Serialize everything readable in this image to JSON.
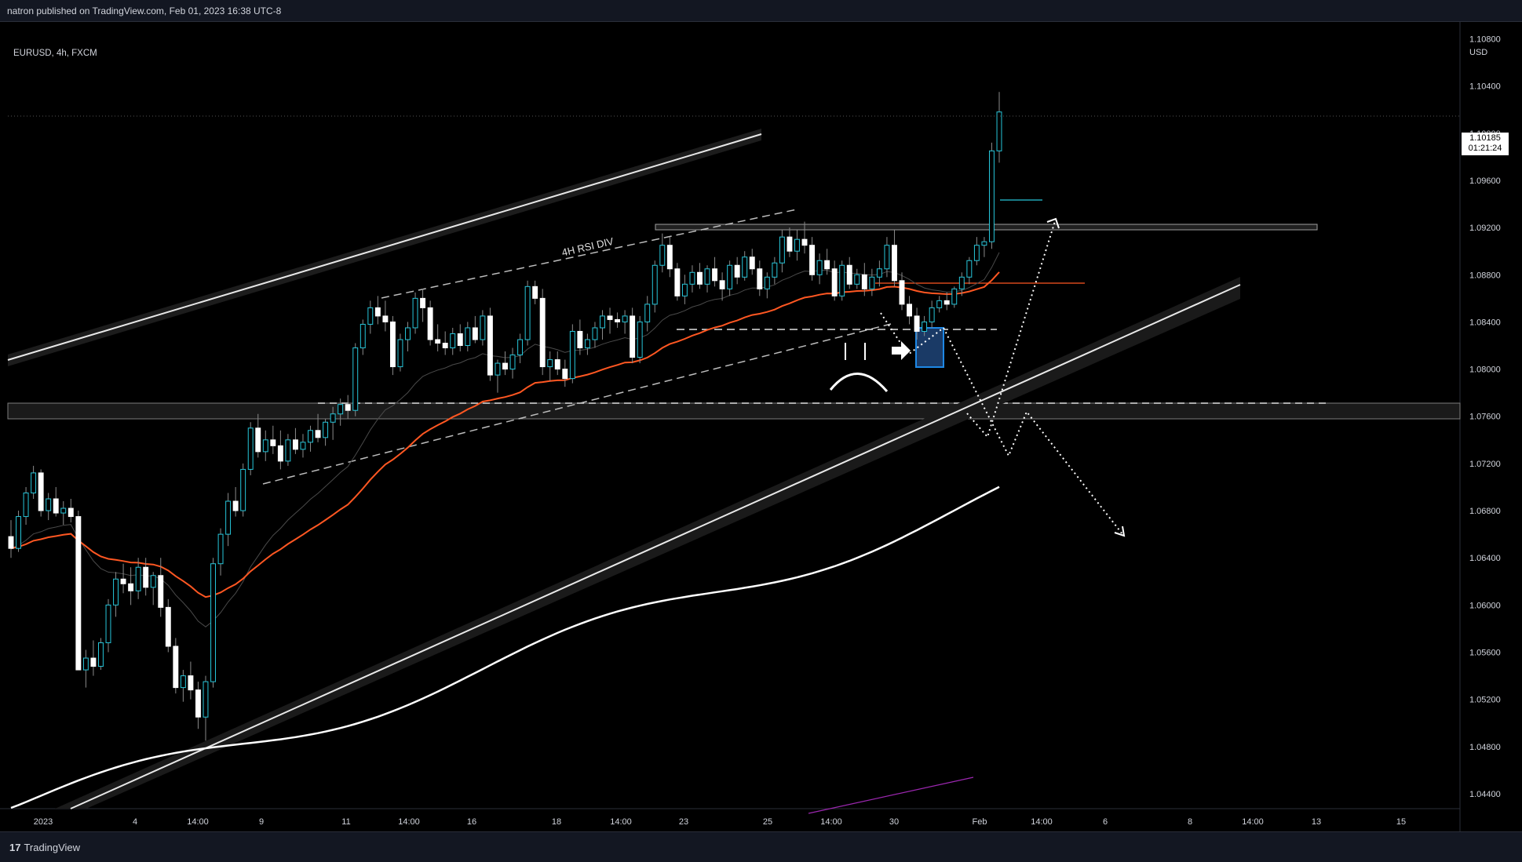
{
  "header": {
    "published_text": "natron published on TradingView.com, Feb 01, 2023 16:38 UTC-8"
  },
  "symbol": {
    "label": "EURUSD, 4h, FXCM",
    "currency": "USD"
  },
  "price_tag": {
    "price": "1.10185",
    "countdown": "01:21:24"
  },
  "footer": {
    "logo_icon": "tradingview-logo-icon",
    "brand": "TradingView"
  },
  "colors": {
    "background": "#000000",
    "candle_up": "#26c6da",
    "candle_down": "#ffffff",
    "ema_orange": "#ff5722",
    "ma_white": "#ffffff",
    "drawing": "#cfcfcf",
    "box_blue": "#1e88e5",
    "purple": "#9c27b0"
  },
  "annotations": {
    "rsi_div": "4H RSI DIV"
  },
  "chart_data": {
    "type": "candlestick",
    "title": "EURUSD, 4h, FXCM",
    "ylabel": "USD",
    "ylim": [
      1.043,
      1.1085
    ],
    "y_ticks": [
      "1.10800",
      "1.10400",
      "1.10000",
      "1.09600",
      "1.09200",
      "1.08800",
      "1.08400",
      "1.08000",
      "1.07600",
      "1.07200",
      "1.06800",
      "1.06400",
      "1.06000",
      "1.05600",
      "1.05200",
      "1.04800",
      "1.04400"
    ],
    "x_ticks": [
      "2023",
      "4",
      "14:00",
      "9",
      "11",
      "14:00",
      "16",
      "18",
      "14:00",
      "23",
      "25",
      "14:00",
      "30",
      "Feb",
      "14:00",
      "6",
      "8",
      "14:00",
      "13",
      "15"
    ],
    "last_price": 1.10185,
    "grid": false,
    "series": [
      {
        "values": [
          [
            1.0658,
            1.0672,
            1.064,
            1.0648
          ],
          [
            1.0648,
            1.068,
            1.0645,
            1.0675
          ],
          [
            1.0675,
            1.07,
            1.0668,
            1.0695
          ],
          [
            1.0695,
            1.0718,
            1.069,
            1.0712
          ],
          [
            1.0712,
            1.0715,
            1.0675,
            1.068
          ],
          [
            1.068,
            1.0695,
            1.0672,
            1.069
          ],
          [
            1.069,
            1.07,
            1.0675,
            1.0678
          ],
          [
            1.0678,
            1.0688,
            1.0668,
            1.0682
          ],
          [
            1.0682,
            1.069,
            1.067,
            1.0675
          ],
          [
            1.0675,
            1.068,
            1.057,
            1.0545
          ],
          [
            1.0545,
            1.0562,
            1.053,
            1.0555
          ],
          [
            1.0555,
            1.057,
            1.054,
            1.0548
          ],
          [
            1.0548,
            1.0572,
            1.0545,
            1.0568
          ],
          [
            1.0568,
            1.0605,
            1.056,
            1.06
          ],
          [
            1.06,
            1.0628,
            1.059,
            1.0622
          ],
          [
            1.0622,
            1.0635,
            1.061,
            1.0618
          ],
          [
            1.0618,
            1.0632,
            1.06,
            1.0612
          ],
          [
            1.0612,
            1.064,
            1.0605,
            1.0632
          ],
          [
            1.0632,
            1.064,
            1.0608,
            1.0615
          ],
          [
            1.0615,
            1.0628,
            1.06,
            1.0625
          ],
          [
            1.0625,
            1.064,
            1.059,
            1.0598
          ],
          [
            1.0598,
            1.0605,
            1.056,
            1.0565
          ],
          [
            1.0565,
            1.0572,
            1.0525,
            1.053
          ],
          [
            1.053,
            1.0545,
            1.0518,
            1.054
          ],
          [
            1.054,
            1.0552,
            1.052,
            1.0528
          ],
          [
            1.0528,
            1.0535,
            1.0495,
            1.0505
          ],
          [
            1.0505,
            1.054,
            1.0485,
            1.0535
          ],
          [
            1.0535,
            1.064,
            1.053,
            1.0635
          ],
          [
            1.0635,
            1.0665,
            1.0625,
            1.066
          ],
          [
            1.066,
            1.0695,
            1.065,
            1.0688
          ],
          [
            1.0688,
            1.07,
            1.0675,
            1.068
          ],
          [
            1.068,
            1.072,
            1.0675,
            1.0715
          ],
          [
            1.0715,
            1.0755,
            1.071,
            1.075
          ],
          [
            1.075,
            1.0762,
            1.0725,
            1.073
          ],
          [
            1.073,
            1.0748,
            1.0722,
            1.074
          ],
          [
            1.074,
            1.0752,
            1.0728,
            1.0735
          ],
          [
            1.0735,
            1.0748,
            1.0715,
            1.0722
          ],
          [
            1.0722,
            1.0745,
            1.0718,
            1.074
          ],
          [
            1.074,
            1.075,
            1.0728,
            1.0732
          ],
          [
            1.0732,
            1.0745,
            1.0725,
            1.0738
          ],
          [
            1.0738,
            1.0752,
            1.073,
            1.0748
          ],
          [
            1.0748,
            1.0762,
            1.0738,
            1.0742
          ],
          [
            1.0742,
            1.0758,
            1.0735,
            1.0755
          ],
          [
            1.0755,
            1.0768,
            1.074,
            1.0762
          ],
          [
            1.0762,
            1.0775,
            1.0752,
            1.077
          ],
          [
            1.077,
            1.0778,
            1.0758,
            1.0765
          ],
          [
            1.0765,
            1.0822,
            1.076,
            1.0818
          ],
          [
            1.0818,
            1.0842,
            1.0812,
            1.0838
          ],
          [
            1.0838,
            1.0858,
            1.083,
            1.0852
          ],
          [
            1.0852,
            1.0862,
            1.0838,
            1.0845
          ],
          [
            1.0845,
            1.0858,
            1.0832,
            1.084
          ],
          [
            1.084,
            1.0845,
            1.0795,
            1.0802
          ],
          [
            1.0802,
            1.083,
            1.0798,
            1.0825
          ],
          [
            1.0825,
            1.084,
            1.0815,
            1.0835
          ],
          [
            1.0835,
            1.0865,
            1.083,
            1.086
          ],
          [
            1.086,
            1.0868,
            1.084,
            1.0852
          ],
          [
            1.0852,
            1.0858,
            1.082,
            1.0825
          ],
          [
            1.0825,
            1.0838,
            1.0815,
            1.0822
          ],
          [
            1.0822,
            1.0832,
            1.0812,
            1.0818
          ],
          [
            1.0818,
            1.0835,
            1.0812,
            1.083
          ],
          [
            1.083,
            1.0838,
            1.0815,
            1.082
          ],
          [
            1.082,
            1.084,
            1.0815,
            1.0835
          ],
          [
            1.0835,
            1.0845,
            1.0822,
            1.0825
          ],
          [
            1.0825,
            1.085,
            1.082,
            1.0845
          ],
          [
            1.0845,
            1.0852,
            1.079,
            1.0795
          ],
          [
            1.0795,
            1.0808,
            1.078,
            1.0805
          ],
          [
            1.0805,
            1.0815,
            1.0795,
            1.08
          ],
          [
            1.08,
            1.0818,
            1.0792,
            1.0812
          ],
          [
            1.0812,
            1.083,
            1.0805,
            1.0825
          ],
          [
            1.0825,
            1.0875,
            1.082,
            1.087
          ],
          [
            1.087,
            1.0875,
            1.0855,
            1.086
          ],
          [
            1.086,
            1.0868,
            1.0795,
            1.0802
          ],
          [
            1.0802,
            1.0815,
            1.079,
            1.0808
          ],
          [
            1.0808,
            1.0815,
            1.0795,
            1.08
          ],
          [
            1.08,
            1.0808,
            1.0785,
            1.0792
          ],
          [
            1.0792,
            1.0838,
            1.0788,
            1.0832
          ],
          [
            1.0832,
            1.0842,
            1.0812,
            1.0818
          ],
          [
            1.0818,
            1.083,
            1.0812,
            1.0825
          ],
          [
            1.0825,
            1.084,
            1.0818,
            1.0835
          ],
          [
            1.0835,
            1.085,
            1.0825,
            1.0845
          ],
          [
            1.0845,
            1.0852,
            1.083,
            1.0842
          ],
          [
            1.0842,
            1.0848,
            1.0835,
            1.084
          ],
          [
            1.084,
            1.085,
            1.083,
            1.0845
          ],
          [
            1.0845,
            1.0852,
            1.0805,
            1.081
          ],
          [
            1.081,
            1.0845,
            1.0805,
            1.084
          ],
          [
            1.084,
            1.0862,
            1.0832,
            1.0855
          ],
          [
            1.0855,
            1.0892,
            1.0848,
            1.0888
          ],
          [
            1.0888,
            1.0915,
            1.0882,
            1.0905
          ],
          [
            1.0905,
            1.0912,
            1.0878,
            1.0885
          ],
          [
            1.0885,
            1.089,
            1.0858,
            1.0862
          ],
          [
            1.0862,
            1.088,
            1.0855,
            1.0872
          ],
          [
            1.0872,
            1.0888,
            1.0865,
            1.0882
          ],
          [
            1.0882,
            1.089,
            1.0868,
            1.0872
          ],
          [
            1.0872,
            1.0888,
            1.0865,
            1.0885
          ],
          [
            1.0885,
            1.0895,
            1.087,
            1.0875
          ],
          [
            1.0875,
            1.0882,
            1.0858,
            1.0868
          ],
          [
            1.0868,
            1.0892,
            1.0862,
            1.0888
          ],
          [
            1.0888,
            1.0895,
            1.0872,
            1.0878
          ],
          [
            1.0878,
            1.09,
            1.0875,
            1.0895
          ],
          [
            1.0895,
            1.0902,
            1.088,
            1.0885
          ],
          [
            1.0885,
            1.0892,
            1.0862,
            1.0868
          ],
          [
            1.0868,
            1.0882,
            1.086,
            1.0878
          ],
          [
            1.0878,
            1.0895,
            1.0872,
            1.089
          ],
          [
            1.089,
            1.0918,
            1.0882,
            1.0912
          ],
          [
            1.0912,
            1.092,
            1.0895,
            1.09
          ],
          [
            1.09,
            1.0918,
            1.0892,
            1.091
          ],
          [
            1.091,
            1.0925,
            1.0898,
            1.0905
          ],
          [
            1.0905,
            1.0912,
            1.0875,
            1.088
          ],
          [
            1.088,
            1.0898,
            1.0872,
            1.0892
          ],
          [
            1.0892,
            1.0902,
            1.088,
            1.0885
          ],
          [
            1.0885,
            1.0892,
            1.0858,
            1.0862
          ],
          [
            1.0862,
            1.0892,
            1.0858,
            1.0888
          ],
          [
            1.0888,
            1.0895,
            1.0868,
            1.0872
          ],
          [
            1.0872,
            1.0885,
            1.0868,
            1.088
          ],
          [
            1.088,
            1.089,
            1.0862,
            1.0868
          ],
          [
            1.0868,
            1.0885,
            1.0862,
            1.0878
          ],
          [
            1.0878,
            1.0892,
            1.087,
            1.0885
          ],
          [
            1.0885,
            1.0912,
            1.0878,
            1.0905
          ],
          [
            1.0905,
            1.0918,
            1.087,
            1.0875
          ],
          [
            1.0875,
            1.0882,
            1.085,
            1.0855
          ],
          [
            1.0855,
            1.0862,
            1.0838,
            1.0845
          ],
          [
            1.0845,
            1.0852,
            1.0825,
            1.0832
          ],
          [
            1.0832,
            1.0845,
            1.0828,
            1.084
          ],
          [
            1.084,
            1.0858,
            1.0835,
            1.0852
          ],
          [
            1.0852,
            1.0862,
            1.0848,
            1.0858
          ],
          [
            1.0858,
            1.0865,
            1.085,
            1.0855
          ],
          [
            1.0855,
            1.087,
            1.0852,
            1.0868
          ],
          [
            1.0868,
            1.0882,
            1.0862,
            1.0878
          ],
          [
            1.0878,
            1.0895,
            1.0872,
            1.0892
          ],
          [
            1.0892,
            1.0912,
            1.0888,
            1.0905
          ],
          [
            1.0905,
            1.0912,
            1.0895,
            1.0908
          ],
          [
            1.0908,
            1.0992,
            1.0902,
            1.0985
          ],
          [
            1.0985,
            1.1035,
            1.0975,
            1.1018
          ]
        ]
      }
    ]
  }
}
